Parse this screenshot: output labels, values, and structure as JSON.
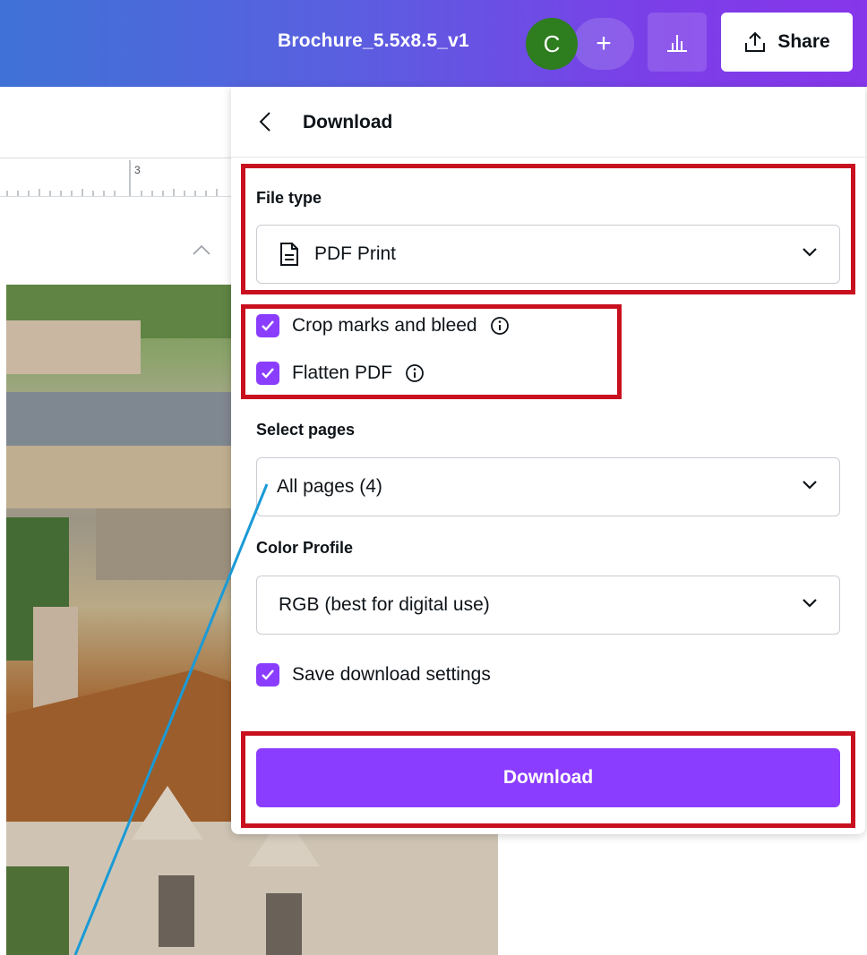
{
  "topbar": {
    "document_title": "Brochure_5.5x8.5_v1",
    "avatar_initial": "C",
    "add_symbol": "+",
    "share_label": "Share"
  },
  "ruler": {
    "mark": "3"
  },
  "panel": {
    "title": "Download",
    "file_type": {
      "label": "File type",
      "value": "PDF Print"
    },
    "options": {
      "crop_marks": {
        "label": "Crop marks and bleed",
        "checked": true
      },
      "flatten_pdf": {
        "label": "Flatten PDF",
        "checked": true
      }
    },
    "select_pages": {
      "label": "Select pages",
      "value": "All pages (4)"
    },
    "color_profile": {
      "label": "Color Profile",
      "value": "RGB (best for digital use)"
    },
    "save_settings": {
      "label": "Save download settings",
      "checked": true
    },
    "download_button": "Download"
  },
  "colors": {
    "accent": "#8b3dff",
    "highlight": "#c8101f",
    "avatar": "#2e7d1f",
    "annotation_line": "#1a9ad6"
  },
  "icons": [
    "chevron-left-icon",
    "document-icon",
    "chevron-down-icon",
    "info-icon",
    "check-icon",
    "share-upload-icon",
    "bar-chart-icon"
  ]
}
